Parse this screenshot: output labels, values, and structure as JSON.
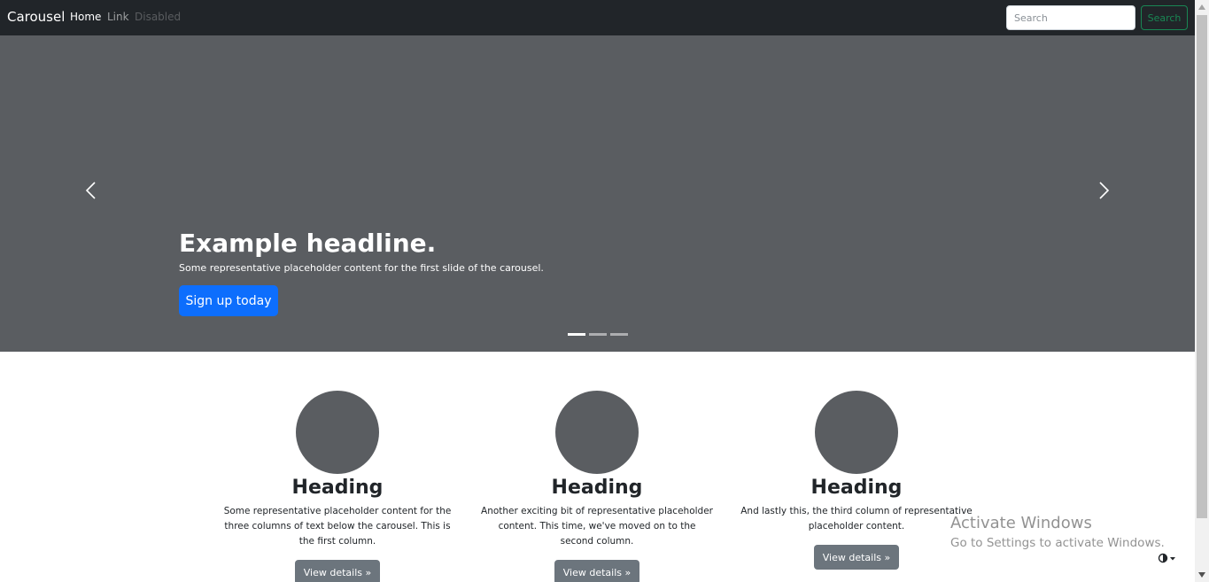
{
  "navbar": {
    "brand": "Carousel",
    "links": [
      {
        "label": "Home"
      },
      {
        "label": "Link"
      },
      {
        "label": "Disabled"
      }
    ],
    "search_placeholder": "Search",
    "search_button": "Search"
  },
  "carousel": {
    "headline": "Example headline.",
    "caption": "Some representative placeholder content for the first slide of the carousel.",
    "button": "Sign up today",
    "prev_icon": "chevron-left-icon",
    "next_icon": "chevron-right-icon",
    "slide_count": 3,
    "active_slide": 1
  },
  "columns": [
    {
      "heading": "Heading",
      "text": "Some representative placeholder content for the three columns of text below the carousel. This is the first column.",
      "button": "View details »"
    },
    {
      "heading": "Heading",
      "text": "Another exciting bit of representative placeholder content. This time, we've moved on to the second column.",
      "button": "View details »"
    },
    {
      "heading": "Heading",
      "text": "And lastly this, the third column of representative placeholder content.",
      "button": "View details »"
    }
  ],
  "watermark": {
    "title": "Activate Windows",
    "subtitle": "Go to Settings to activate Windows."
  },
  "theme_toggle_icon": "contrast-icon",
  "colors": {
    "navbar_bg": "#212529",
    "carousel_bg": "#5a5d61",
    "primary": "#0d6efd",
    "success": "#198754",
    "secondary": "#6c757d"
  }
}
